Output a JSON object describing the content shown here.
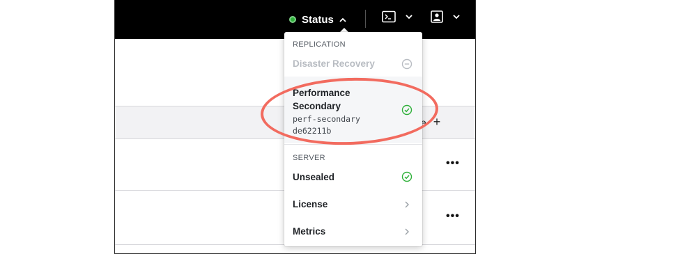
{
  "navbar": {
    "status_label": "Status",
    "status_color": "#2eb039",
    "icons": [
      "terminal-icon",
      "user-icon"
    ]
  },
  "background": {
    "enable_engine_partial": "ine",
    "add_symbol": "+",
    "row_menu_symbol": "•••"
  },
  "dropdown": {
    "replication_heading": "REPLICATION",
    "disaster_recovery": {
      "label": "Disaster Recovery",
      "state": "disabled"
    },
    "performance_secondary": {
      "label": "Performance Secondary",
      "cluster_name": "perf-secondary",
      "cluster_id": "de62211b",
      "state": "ok"
    },
    "server_heading": "SERVER",
    "unsealed": {
      "label": "Unsealed",
      "state": "ok"
    },
    "license": {
      "label": "License"
    },
    "metrics": {
      "label": "Metrics"
    }
  },
  "colors": {
    "ok_green": "#2eb039",
    "annotation_red": "#f26b5f"
  }
}
